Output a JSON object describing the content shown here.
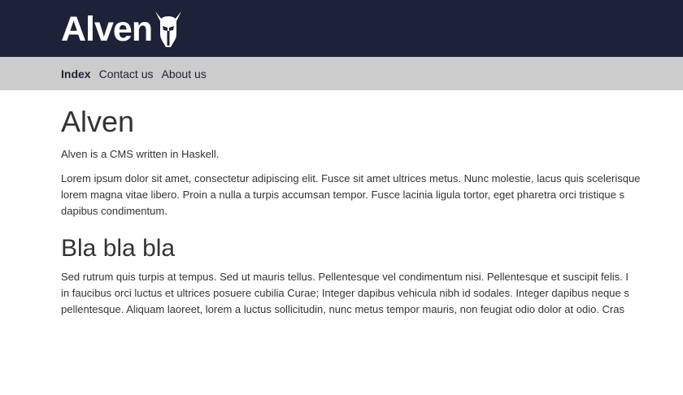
{
  "header": {
    "logo_text": "Alven",
    "logo_icon": "spartan-helmet-icon",
    "bg_color": "#1d2238"
  },
  "nav": {
    "items": [
      {
        "label": "Index",
        "active": true
      },
      {
        "label": "Contact us",
        "active": false
      },
      {
        "label": "About us",
        "active": false
      }
    ]
  },
  "main": {
    "title": "Alven",
    "intro": "Alven is a CMS written in Haskell.",
    "paragraph1": "Lorem ipsum dolor sit amet, consectetur adipiscing elit. Fusce sit amet ultrices metus. Nunc molestie, lacus quis scelerisque\nlorem magna vitae libero. Proin a nulla a turpis accumsan tempor. Fusce lacinia ligula tortor, eget pharetra orci tristique s\ndapibus condimentum.",
    "section_title": "Bla bla bla",
    "paragraph2": "Sed rutrum quis turpis at tempus. Sed ut mauris tellus. Pellentesque vel condimentum nisi. Pellentesque et suscipit felis. I\nin faucibus orci luctus et ultrices posuere cubilia Curae; Integer dapibus vehicula nibh id sodales. Integer dapibus neque s\npellentesque. Aliquam laoreet, lorem a luctus sollicitudin, nunc metus tempor mauris, non feugiat odio dolor at odio. Cras"
  }
}
